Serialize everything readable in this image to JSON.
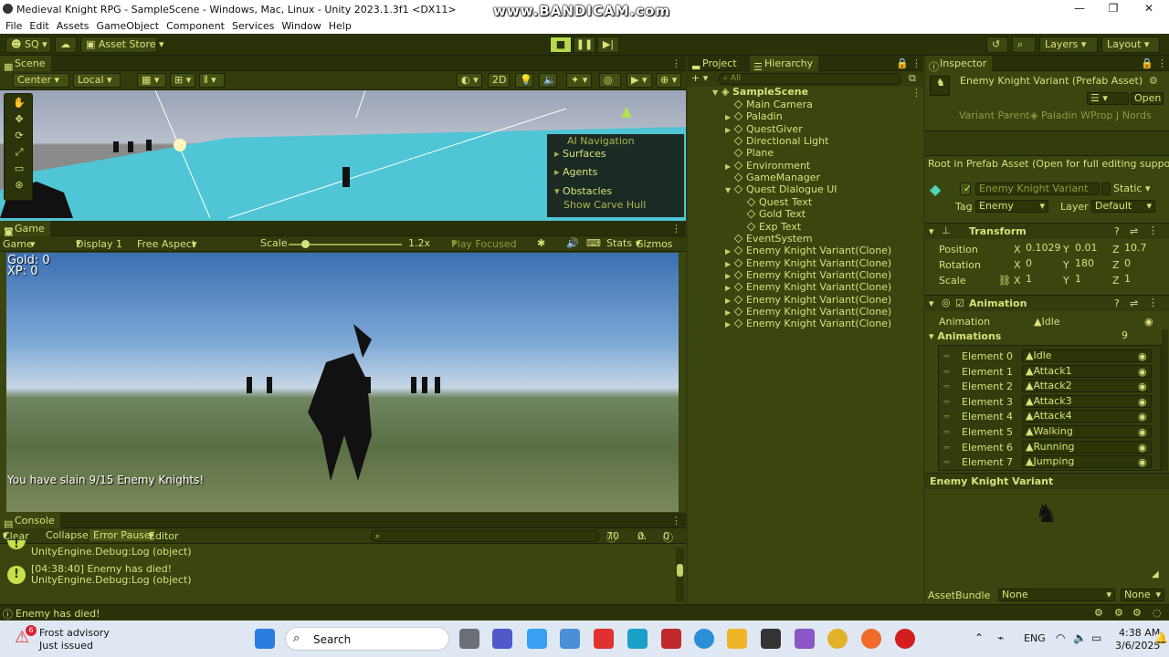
{
  "window": {
    "title": "Medieval Knight RPG - SampleScene - Windows, Mac, Linux - Unity 2023.1.3f1 <DX11>",
    "watermark": "www.BANDICAM.com",
    "minimize": "—",
    "maximize": "❐",
    "close": "✕"
  },
  "menu": [
    "File",
    "Edit",
    "Assets",
    "GameObject",
    "Component",
    "Services",
    "Window",
    "Help"
  ],
  "toolbar": {
    "account": "SQ",
    "asset_store": "Asset Store",
    "layers": "Layers",
    "layout": "Layout"
  },
  "scene": {
    "tab": "Scene",
    "pivot": "Center",
    "space": "Local",
    "mode_2d": "2D",
    "ai_nav": {
      "title": "AI Navigation",
      "items": [
        "Surfaces",
        "Agents",
        "Obstacles",
        "Show Carve Hull"
      ]
    }
  },
  "game": {
    "tab": "Game",
    "display_mode": "Game",
    "display": "Display 1",
    "aspect": "Free Aspect",
    "scale_label": "Scale",
    "scale_value": "1.2x",
    "play_focused": "Play Focused",
    "stats": "Stats",
    "gizmos": "Gizmos",
    "hud": {
      "gold": "Gold: 0",
      "xp": "XP: 0",
      "message": "You have slain 9/15 Enemy Knights!"
    }
  },
  "console": {
    "tab": "Console",
    "clear": "Clear",
    "collapse": "Collapse",
    "error_pause": "Error Pause",
    "editor": "Editor",
    "counts": {
      "log": "70",
      "warn": "0",
      "error": "0"
    },
    "entries": [
      {
        "line1": "",
        "line2": "UnityEngine.Debug:Log (object)"
      },
      {
        "line1": "[04:38:40] Enemy has died!",
        "line2": "UnityEngine.Debug:Log (object)"
      }
    ]
  },
  "status": {
    "message": "Enemy has died!"
  },
  "hierarchy": {
    "project_tab": "Project",
    "hierarchy_tab": "Hierarchy",
    "search_placeholder": "All",
    "scene": "SampleScene",
    "items": [
      {
        "name": "Main Camera",
        "indent": 1,
        "arrow": ""
      },
      {
        "name": "Paladin",
        "indent": 1,
        "arrow": "▶"
      },
      {
        "name": "QuestGiver",
        "indent": 1,
        "arrow": "▶"
      },
      {
        "name": "Directional Light",
        "indent": 1,
        "arrow": ""
      },
      {
        "name": "Plane",
        "indent": 1,
        "arrow": ""
      },
      {
        "name": "Environment",
        "indent": 1,
        "arrow": "▶"
      },
      {
        "name": "GameManager",
        "indent": 1,
        "arrow": ""
      },
      {
        "name": "Quest Dialogue UI",
        "indent": 1,
        "arrow": "▼"
      },
      {
        "name": "Quest Text",
        "indent": 2,
        "arrow": ""
      },
      {
        "name": "Gold Text",
        "indent": 2,
        "arrow": ""
      },
      {
        "name": "Exp Text",
        "indent": 2,
        "arrow": ""
      },
      {
        "name": "EventSystem",
        "indent": 1,
        "arrow": ""
      },
      {
        "name": "Enemy Knight Variant(Clone)",
        "indent": 1,
        "arrow": "▶"
      },
      {
        "name": "Enemy Knight Variant(Clone)",
        "indent": 1,
        "arrow": "▶"
      },
      {
        "name": "Enemy Knight Variant(Clone)",
        "indent": 1,
        "arrow": "▶"
      },
      {
        "name": "Enemy Knight Variant(Clone)",
        "indent": 1,
        "arrow": "▶"
      },
      {
        "name": "Enemy Knight Variant(Clone)",
        "indent": 1,
        "arrow": "▶"
      },
      {
        "name": "Enemy Knight Variant(Clone)",
        "indent": 1,
        "arrow": "▶"
      },
      {
        "name": "Enemy Knight Variant(Clone)",
        "indent": 1,
        "arrow": "▶"
      }
    ]
  },
  "inspector": {
    "tab": "Inspector",
    "asset_title": "Enemy Knight Variant (Prefab Asset)",
    "open": "Open",
    "variant_parent_label": "Variant Parent",
    "variant_parent_value": "Paladin WProp J Nords",
    "root_note": "Root in Prefab Asset (Open for full editing support)",
    "object_name": "Enemy Knight Variant",
    "static": "Static",
    "tag_label": "Tag",
    "tag_value": "Enemy",
    "layer_label": "Layer",
    "layer_value": "Default",
    "transform": {
      "title": "Transform",
      "position_label": "Position",
      "rotation_label": "Rotation",
      "scale_label": "Scale",
      "position": [
        "0.1029",
        "0.01",
        "10.7"
      ],
      "rotation": [
        "0",
        "180",
        "0"
      ],
      "scale": [
        "1",
        "1",
        "1"
      ]
    },
    "animation": {
      "title": "Animation",
      "clip_label": "Animation",
      "clip_value": "Idle",
      "list_label": "Animations",
      "count": "9",
      "elements": [
        {
          "label": "Element 0",
          "value": "Idle"
        },
        {
          "label": "Element 1",
          "value": "Attack1"
        },
        {
          "label": "Element 2",
          "value": "Attack2"
        },
        {
          "label": "Element 3",
          "value": "Attack3"
        },
        {
          "label": "Element 4",
          "value": "Attack4"
        },
        {
          "label": "Element 5",
          "value": "Walking"
        },
        {
          "label": "Element 6",
          "value": "Running"
        },
        {
          "label": "Element 7",
          "value": "Jumping"
        }
      ]
    },
    "preview_title": "Enemy Knight Variant",
    "asset_bundle_label": "AssetBundle",
    "asset_bundle_value": "None",
    "asset_bundle_variant": "None"
  },
  "taskbar": {
    "weather_title": "Frost advisory",
    "weather_sub": "Just issued",
    "weather_badge": "6",
    "search": "Search",
    "lang": "ENG",
    "time": "4:38 AM",
    "date": "3/6/2025"
  }
}
